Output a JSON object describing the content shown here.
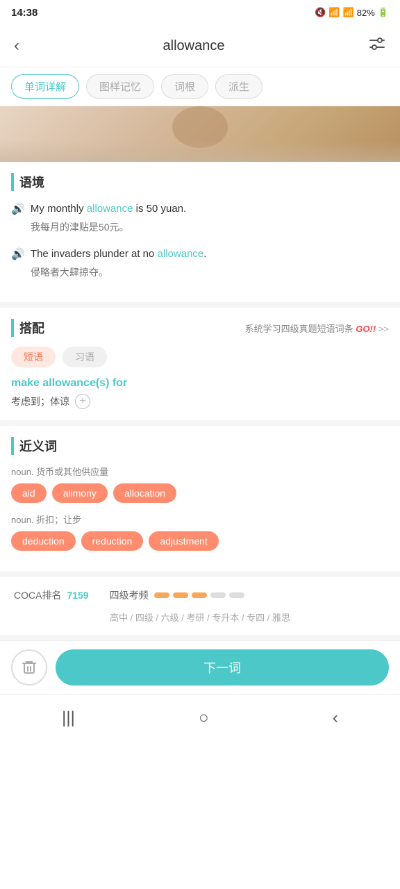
{
  "statusBar": {
    "time": "14:38",
    "battery": "82%"
  },
  "header": {
    "back": "‹",
    "title": "allowance",
    "filter": "⊟"
  },
  "tabs": [
    {
      "id": "detail",
      "label": "单词详解",
      "active": true
    },
    {
      "id": "image",
      "label": "图样记忆",
      "active": false
    },
    {
      "id": "root",
      "label": "词根",
      "active": false
    },
    {
      "id": "derived",
      "label": "派生",
      "active": false
    }
  ],
  "context": {
    "title": "语境",
    "sentences": [
      {
        "en_before": "My monthly ",
        "keyword": "allowance",
        "en_after": " is 50 yuan.",
        "zh": "我每月的津贴是50元。"
      },
      {
        "en_before": "The invaders plunder at no ",
        "keyword": "allowance",
        "en_after": ".",
        "zh": "侵略者大肆掠夺。"
      }
    ]
  },
  "collocation": {
    "title": "搭配",
    "link_text": "系统学习四级真题短语词条",
    "go_text": "GO!!",
    "arrow": ">>",
    "type_tabs": [
      {
        "label": "短语",
        "active": true
      },
      {
        "label": "习语",
        "active": false
      }
    ],
    "phrase": "make allowance(s) for",
    "meaning": "考虑到；体谅",
    "add_icon": "+"
  },
  "synonyms": {
    "title": "近义词",
    "groups": [
      {
        "label": "noun. 货币或其他供应量",
        "tags": [
          "aid",
          "alimony",
          "allocation"
        ]
      },
      {
        "label": "noun. 折扣；让步",
        "tags": [
          "deduction",
          "reduction",
          "adjustment"
        ]
      }
    ]
  },
  "stats": {
    "coca_label": "COCA排名",
    "coca_value": "7159",
    "freq_label": "四级考频",
    "freq_filled": 3,
    "freq_empty": 2,
    "levels": "高中 / 四级 / 六级 / 考研 / 专升本 / 专四 / 雅思"
  },
  "bottomBar": {
    "delete_icon": "🗑",
    "next_label": "下一词"
  },
  "navBar": {
    "menu_icon": "|||",
    "home_icon": "○",
    "back_icon": "‹"
  }
}
